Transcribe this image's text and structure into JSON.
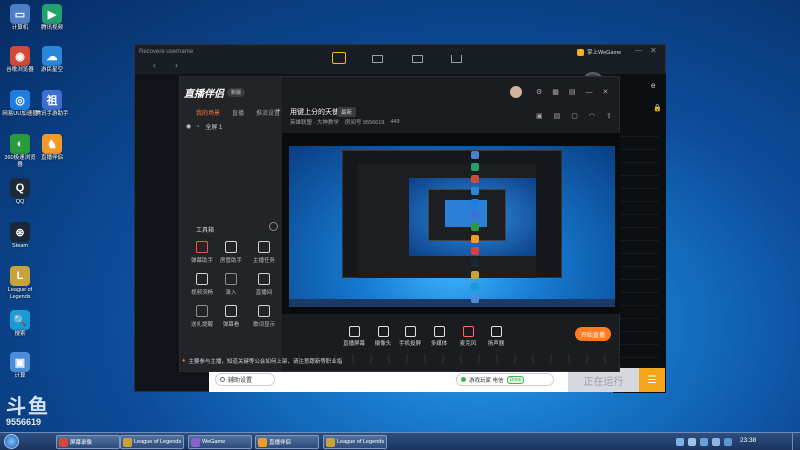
{
  "desktop": {
    "icons": [
      {
        "label": "计算机",
        "color": "#4b7fc8",
        "glyph": "▭",
        "icon": "computer-icon"
      },
      {
        "label": "腾讯视频",
        "color": "#23a16a",
        "glyph": "▶",
        "icon": "tencent-video-icon"
      },
      {
        "label": "谷歌浏览器",
        "color": "#d04a3a",
        "glyph": "◉",
        "icon": "chrome-icon"
      },
      {
        "label": "游民星空",
        "color": "#2a86d6",
        "glyph": "☁",
        "icon": "gamersky-icon"
      },
      {
        "label": "网易UU加速器",
        "color": "#1e7ee0",
        "glyph": "◎",
        "icon": "uu-icon"
      },
      {
        "label": "腾讯手游助手",
        "color": "#3d6fd0",
        "glyph": "祖",
        "icon": "tencent-assistant-icon"
      },
      {
        "label": "360极速浏览器",
        "color": "#2a9b3a",
        "glyph": "◐",
        "icon": "360-browser-icon"
      },
      {
        "label": "直播伴侣",
        "color": "#f09a28",
        "glyph": "♞",
        "icon": "live-companion-icon"
      },
      {
        "label": "QQ",
        "color": "#1d2a3a",
        "glyph": "Q",
        "icon": "qq-icon"
      },
      {
        "label": "Steam",
        "color": "#1b2838",
        "glyph": "⊛",
        "icon": "steam-icon"
      },
      {
        "label": "League of Legends",
        "color": "#c8a23a",
        "glyph": "L",
        "icon": "lol-icon"
      },
      {
        "label": "搜索",
        "color": "#1a9bd8",
        "glyph": "🔍",
        "icon": "search-icon"
      },
      {
        "label": "计算",
        "color": "#4a8cd8",
        "glyph": "▣",
        "icon": "monitor-icon"
      }
    ],
    "watermark_text": "斗鱼",
    "watermark_id": "9556619"
  },
  "wegame": {
    "title": "Recovere username",
    "brand": "掌上WeGame",
    "right_top": "e",
    "bottom_search": "辅助设置",
    "bottom_pill": "游戏玩家 电信",
    "bottom_badge": "Done",
    "run_status": "正在运行"
  },
  "live": {
    "logo": "直播伴侣",
    "version": "新版",
    "tabs": [
      "我的场景",
      "直播",
      "推流设置"
    ],
    "scene_label": "全屏 1",
    "stream_title": "用键上分的天使",
    "stream_tag": "最新",
    "stream_category": "英雄联盟 · 大神教学",
    "stream_room": "房间号 9556619",
    "stream_count": "449",
    "tools_heading": "工具箱",
    "tools": [
      {
        "label": "弹幕助手",
        "icon": "danmu-icon",
        "color": "#e85a3a"
      },
      {
        "label": "房管助手",
        "icon": "admin-icon",
        "color": "#cfd2d6"
      },
      {
        "label": "主播任务",
        "icon": "task-icon",
        "color": "#cfd2d6"
      },
      {
        "label": "视频流畅",
        "icon": "video-icon",
        "color": "#cfd2d6"
      },
      {
        "label": "录入",
        "icon": "record-icon",
        "color": "#8a8e94"
      },
      {
        "label": "直播间",
        "icon": "room-icon",
        "color": "#cfd2d6"
      },
      {
        "label": "送礼提醒",
        "icon": "gift-icon",
        "color": "#8a8e94"
      },
      {
        "label": "弹幕看",
        "icon": "watch-icon",
        "color": "#cfd2d6"
      },
      {
        "label": "歌词显示",
        "icon": "lyrics-icon",
        "color": "#cfd2d6"
      }
    ],
    "controls": [
      {
        "label": "直播屏幕",
        "icon": "screen-icon"
      },
      {
        "label": "摄像头",
        "icon": "camera-icon"
      },
      {
        "label": "手机投屏",
        "icon": "phone-icon"
      },
      {
        "label": "多媒体",
        "icon": "media-icon"
      },
      {
        "label": "麦克风",
        "icon": "mic-icon"
      },
      {
        "label": "扬声器",
        "icon": "speaker-icon"
      }
    ],
    "start_button": "开始直播",
    "notice": "主要参与主播，知道关键等公会如何上架，请注意跟新等职业指"
  },
  "taskbar": {
    "tasks": [
      {
        "label": "屏幕录像",
        "color": "#d04a3a"
      },
      {
        "label": "League of Legends",
        "color": "#c8a23a"
      },
      {
        "label": "WeGame",
        "color": "#8a5fd0"
      },
      {
        "label": "直播伴侣",
        "color": "#f09a28"
      },
      {
        "label": "League of Legends",
        "color": "#c8a23a"
      }
    ],
    "clock": "23:38"
  }
}
